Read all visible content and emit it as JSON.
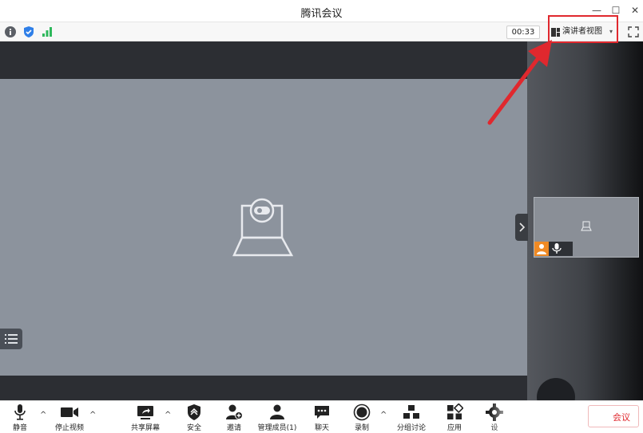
{
  "window": {
    "title": "腾讯会议",
    "minimize": "—",
    "maximize": "☐",
    "close": "✕"
  },
  "topbar": {
    "timer": "00:33",
    "view_label": "演讲者视图",
    "view_caret": "▾"
  },
  "colors": {
    "accent": "#e0282e",
    "signal": "#2eb85c",
    "shield": "#2f7fe8",
    "avatar": "#f08a24"
  },
  "toolbar": {
    "mute": "静音",
    "stop_video": "停止视频",
    "share_screen": "共享屏幕",
    "security": "安全",
    "invite": "邀请",
    "manage_members": "管理成员(1)",
    "chat": "聊天",
    "record": "录制",
    "breakout": "分组讨论",
    "apps": "应用",
    "settings": "设",
    "end_meeting": "会议",
    "chevron": "^"
  },
  "icons": [
    "info-icon",
    "shield-icon",
    "signal-icon",
    "layout-icon",
    "fullscreen-icon",
    "camera-placeholder-icon",
    "list-icon",
    "chevron-right-icon",
    "avatar-icon",
    "mic-icon",
    "video-icon",
    "share-icon",
    "security-icon",
    "invite-icon",
    "members-icon",
    "chat-icon",
    "record-icon",
    "breakout-icon",
    "apps-icon",
    "gear-icon"
  ]
}
